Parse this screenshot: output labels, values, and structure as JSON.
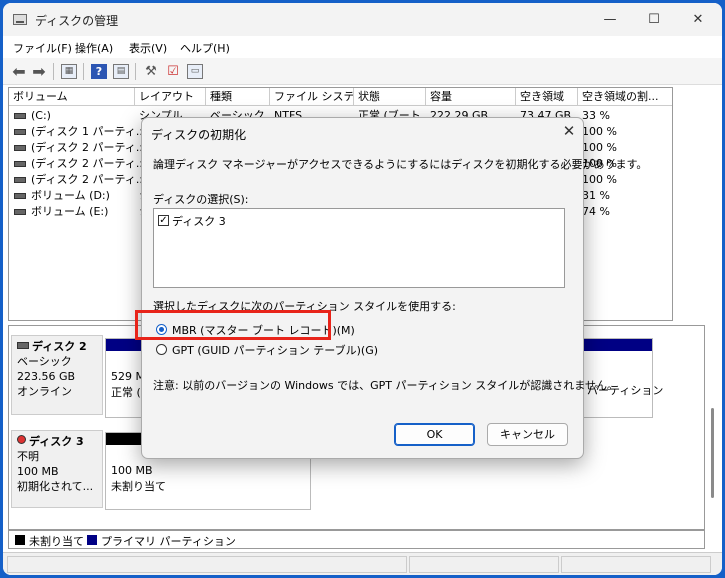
{
  "window": {
    "title": "ディスクの管理",
    "controls": {
      "minimize": "—",
      "maximize": "☐",
      "close": "✕"
    }
  },
  "menu": [
    "ファイル(F)",
    "操作(A)",
    "表示(V)",
    "ヘルプ(H)"
  ],
  "toolbar": {
    "back_icon": "arrow-left-icon",
    "forward_icon": "arrow-right-icon",
    "help_label": "?"
  },
  "volumes": {
    "columns": [
      "ボリューム",
      "レイアウト",
      "種類",
      "ファイル システム",
      "状態",
      "容量",
      "空き領域",
      "空き領域の割..."
    ],
    "rows": [
      {
        "name": "(C:)",
        "layout": "シンプル",
        "type": "ベーシック",
        "fs": "NTFS",
        "status": "正常 (ブート...",
        "capacity": "222.29 GB",
        "free": "73.47 GB",
        "pct": "33 %"
      },
      {
        "name": "(ディスク 1 パーティ...",
        "layout": "シ",
        "type": "",
        "fs": "",
        "status": "",
        "capacity": "",
        "free": "",
        "pct": "100 %"
      },
      {
        "name": "(ディスク 2 パーティ...",
        "layout": "シ",
        "type": "",
        "fs": "",
        "status": "",
        "capacity": "",
        "free": "",
        "pct": "100 %"
      },
      {
        "name": "(ディスク 2 パーティ...",
        "layout": "シ",
        "type": "",
        "fs": "",
        "status": "",
        "capacity": "",
        "free": "",
        "pct": "100 %"
      },
      {
        "name": "(ディスク 2 パーティ...",
        "layout": "シ",
        "type": "",
        "fs": "",
        "status": "",
        "capacity": "",
        "free": "",
        "pct": "100 %"
      },
      {
        "name": "ボリューム (D:)",
        "layout": "シ",
        "type": "",
        "fs": "",
        "status": "",
        "capacity": "",
        "free": "",
        "pct": "31 %"
      },
      {
        "name": "ボリューム (E:)",
        "layout": "シ",
        "type": "",
        "fs": "",
        "status": "",
        "capacity": "",
        "free": "",
        "pct": "74 %"
      }
    ]
  },
  "disks": [
    {
      "name": "ディスク 2",
      "type": "ベーシック",
      "size": "223.56 GB",
      "status": "オンライン",
      "part1_size": "529 MB",
      "part1_status": "正常 (",
      "part_right": "パーティション"
    },
    {
      "name": "ディスク 3",
      "type": "不明",
      "size": "100 MB",
      "status": "初期化されて...",
      "part1_size": "100 MB",
      "part1_status": "未割り当て"
    }
  ],
  "legend": {
    "unallocated": "未割り当て",
    "primary": "プライマリ パーティション"
  },
  "colors": {
    "primary": "#000084",
    "unallocated": "#000000",
    "accent": "#1560c8",
    "highlight": "#e8241a"
  },
  "dialog": {
    "title": "ディスクの初期化",
    "close": "✕",
    "message": "論理ディスク マネージャーがアクセスできるようにするにはディスクを初期化する必要があります。",
    "select_label": "ディスクの選択(S):",
    "disk_item": "ディスク 3",
    "style_label": "選択したディスクに次のパーティション スタイルを使用する:",
    "mbr_label": "MBR (マスター ブート レコード)(M)",
    "gpt_label": "GPT (GUID パーティション テーブル)(G)",
    "note": "注意: 以前のバージョンの Windows では、GPT パーティション スタイルが認識されません。",
    "ok": "OK",
    "cancel": "キャンセル"
  }
}
